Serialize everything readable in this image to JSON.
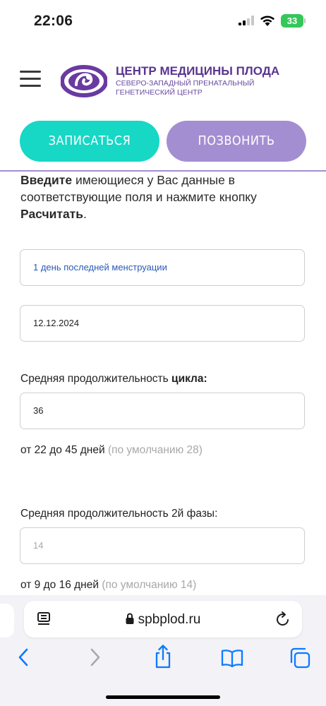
{
  "status_bar": {
    "time": "22:06",
    "battery": "33"
  },
  "header": {
    "logo_title": "ЦЕНТР МЕДИЦИНЫ ПЛОДА",
    "logo_subtitle_line1": "СЕВЕРО-ЗАПАДНЫЙ ПРЕНАТАЛЬНЫЙ",
    "logo_subtitle_line2": "ГЕНЕТИЧЕСКИЙ ЦЕНТР",
    "signup_label": "ЗАПИСАТЬСЯ",
    "call_label": "ПОЗВОНИТЬ",
    "colors": {
      "primary": "#17d7c5",
      "secondary": "#a48ed2",
      "brand": "#5a3490"
    }
  },
  "intro": {
    "bold_start": "Введите",
    "middle": " имеющиеся у Вас данные в соответствующие поля и нажмите кнопку ",
    "bold_end": "Расчитать",
    "end": "."
  },
  "form": {
    "mode_select": "1 день последней менструации",
    "date_value": "12.12.2024",
    "cycle_label_start": "Средняя продолжительность ",
    "cycle_label_bold": "цикла:",
    "cycle_value": "36",
    "cycle_hint": "от 22 до 45 дней",
    "cycle_default": "(по умолчанию 28)",
    "phase_label": "Средняя продолжительность 2й фазы:",
    "phase_placeholder": "14",
    "phase_hint": "от 9 до 16 дней",
    "phase_default": "(по умолчанию 14)"
  },
  "browser": {
    "url": "spbplod.ru"
  },
  "icons": [
    "menu-icon",
    "logo-icon",
    "signal-icon",
    "wifi-icon",
    "lock-icon",
    "reader-icon",
    "reload-icon",
    "back-icon",
    "forward-icon",
    "share-icon",
    "bookmarks-icon",
    "tabs-icon"
  ]
}
